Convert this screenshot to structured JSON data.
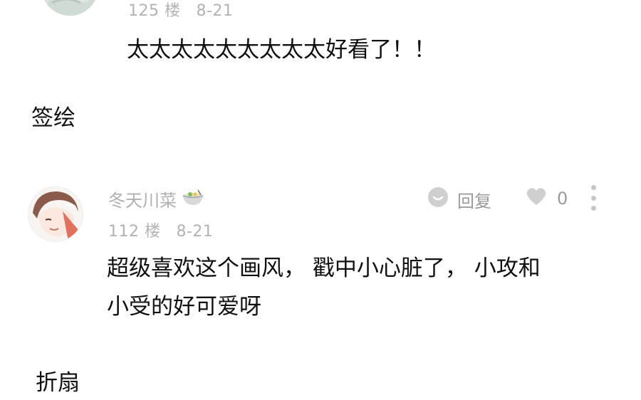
{
  "comments": [
    {
      "floor": "125 楼",
      "date": "8-21",
      "text_lines": [
        "太太太太太太太太太好看了！！"
      ]
    },
    {
      "username": "冬天川菜",
      "floor": "112 楼",
      "date": "8-21",
      "text_lines": [
        "超级喜欢这个画风， 戳中小心脏了， 小攻和",
        "小受的好可爱呀"
      ],
      "actions": {
        "reply_label": "回复",
        "like_count": "0"
      }
    }
  ],
  "reaction_bars": [
    {
      "label": "签绘"
    },
    {
      "label": "折扇"
    }
  ],
  "icons": {
    "reply": "reply-bubble-icon",
    "like": "heart-icon",
    "more": "more-vertical-icon",
    "username_badge": "noodle-bowl-icon"
  },
  "colors": {
    "meta_text": "#b3b3b3",
    "action_icon": "#c6c6c6",
    "body_text": "#111111"
  }
}
